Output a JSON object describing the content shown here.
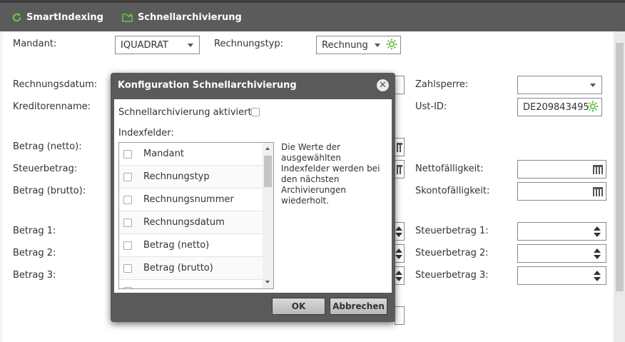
{
  "toolbar": {
    "smartindexing_label": "SmartIndexing",
    "schnellarchivierung_label": "Schnellarchivierung",
    "accent_color": "#6cc04a"
  },
  "form": {
    "mandant_label": "Mandant:",
    "mandant_value": "IQUADRAT",
    "rechnungstyp_label": "Rechnungstyp:",
    "rechnungstyp_value": "Rechnung",
    "rechnungsdatum_label": "Rechnungsdatum:",
    "kreditorenname_label": "Kreditorenname:",
    "zahlsperre_label": "Zahlsperre:",
    "zahlsperre_value": "",
    "ustid_label": "Ust-ID:",
    "ustid_value": "DE209843495",
    "betrag_netto_label": "Betrag (netto):",
    "steuerbetrag_label": "Steuerbetrag:",
    "betrag_brutto_label": "Betrag (brutto):",
    "nettofaelligkeit_label": "Nettofälligkeit:",
    "skontofaelligkeit_label": "Skontofälligkeit:",
    "betrag1_label": "Betrag 1:",
    "betrag2_label": "Betrag 2:",
    "betrag3_label": "Betrag 3:",
    "steuerbetrag1_label": "Steuerbetrag 1:",
    "steuerbetrag2_label": "Steuerbetrag 2:",
    "steuerbetrag3_label": "Steuerbetrag 3:"
  },
  "dialog": {
    "title": "Konfiguration Schnellarchivierung",
    "activated_label": "Schnellarchivierung aktiviert:",
    "indexfelder_label": "Indexfelder:",
    "items": [
      {
        "label": "Mandant"
      },
      {
        "label": "Rechnungstyp"
      },
      {
        "label": "Rechnungsnummer"
      },
      {
        "label": "Rechnungsdatum"
      },
      {
        "label": "Betrag (netto)"
      },
      {
        "label": "Betrag (brutto)"
      }
    ],
    "note": "Die Werte der ausgewählten Indexfelder werden bei den nächsten Archivierungen wiederholt.",
    "ok_label": "OK",
    "cancel_label": "Abbrechen"
  }
}
